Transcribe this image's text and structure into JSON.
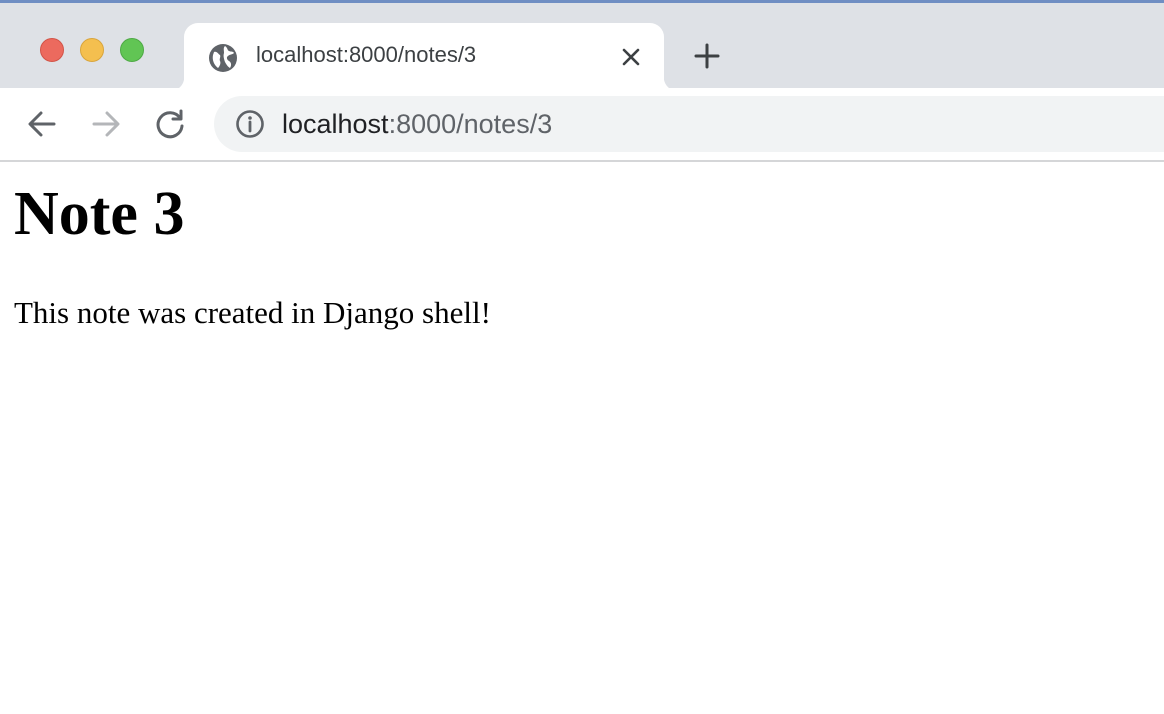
{
  "browser": {
    "colors": {
      "tab_strip": "#dee1e6",
      "omnibox": "#f1f3f4",
      "close_light": "#ec6a5e",
      "minimize_light": "#f4bf4f",
      "zoom_light": "#61c554"
    },
    "window_controls": {
      "close_icon": "traffic-light-close",
      "minimize_icon": "traffic-light-minimize",
      "zoom_icon": "traffic-light-zoom"
    },
    "tab": {
      "favicon_icon": "globe-icon",
      "title": "localhost:8000/notes/3",
      "close_icon": "close-icon"
    },
    "new_tab_icon": "plus-icon",
    "nav": {
      "back_icon": "arrow-left-icon",
      "forward_icon": "arrow-right-icon",
      "reload_icon": "reload-icon"
    },
    "omnibox": {
      "info_icon": "info-icon",
      "url_host": "localhost",
      "url_path": ":8000/notes/3"
    }
  },
  "page": {
    "heading": "Note 3",
    "body": "This note was created in Django shell!"
  }
}
